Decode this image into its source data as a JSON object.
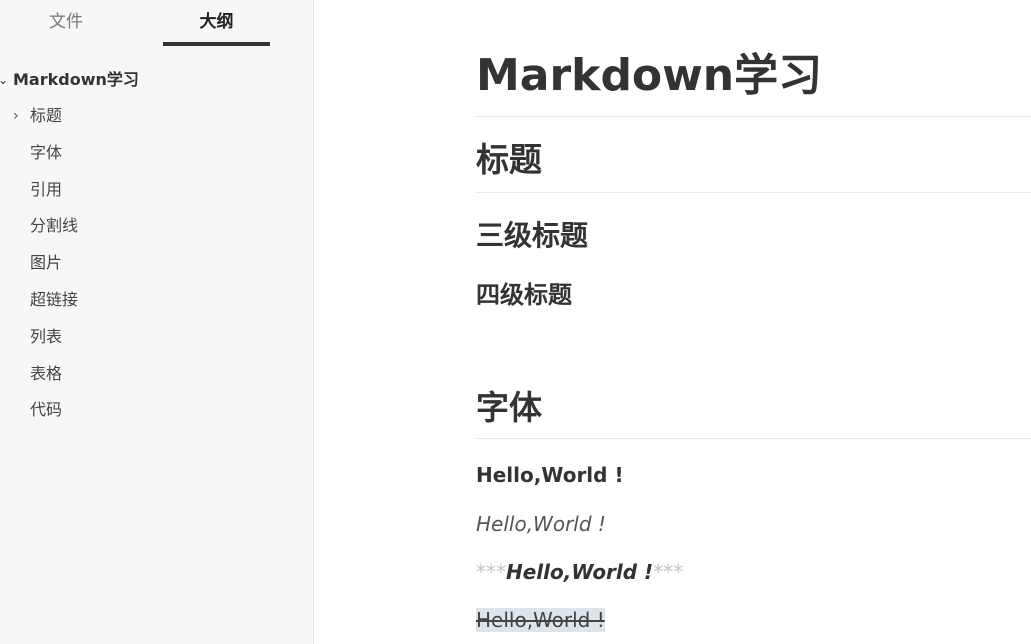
{
  "sidebar": {
    "tabs": [
      {
        "label": "文件",
        "active": false
      },
      {
        "label": "大纲",
        "active": true
      }
    ],
    "outline": {
      "root": {
        "label": "Markdown学习",
        "expanded": true
      },
      "items": [
        {
          "label": "标题",
          "has_children": true
        },
        {
          "label": "字体",
          "has_children": false
        },
        {
          "label": "引用",
          "has_children": false
        },
        {
          "label": "分割线",
          "has_children": false
        },
        {
          "label": "图片",
          "has_children": false
        },
        {
          "label": "超链接",
          "has_children": false
        },
        {
          "label": "列表",
          "has_children": false
        },
        {
          "label": "表格",
          "has_children": false
        },
        {
          "label": "代码",
          "has_children": false
        }
      ]
    }
  },
  "document": {
    "h1": "Markdown学习",
    "h2_headings": "标题",
    "h3": "三级标题",
    "h4": "四级标题",
    "h2_fonts": "字体",
    "bold_text": "Hello,World !",
    "italic_text": "Hello,World !",
    "bold_italic_marker_open": "***",
    "bold_italic_text": "Hello,World !",
    "bold_italic_marker_close": "***",
    "strike_text": "Hello,World !"
  },
  "icons": {
    "expand_root": "chevron-down-icon",
    "collapsed_item": "chevron-right-icon",
    "mouse_cursor": "text-cursor-icon"
  },
  "colors": {
    "sidebar_bg": "#f7f7f7",
    "active_tab_underline": "#333333",
    "text": "#333333",
    "syntax_marker": "#c4c4c4",
    "strike_highlight": "#dde4ea"
  }
}
